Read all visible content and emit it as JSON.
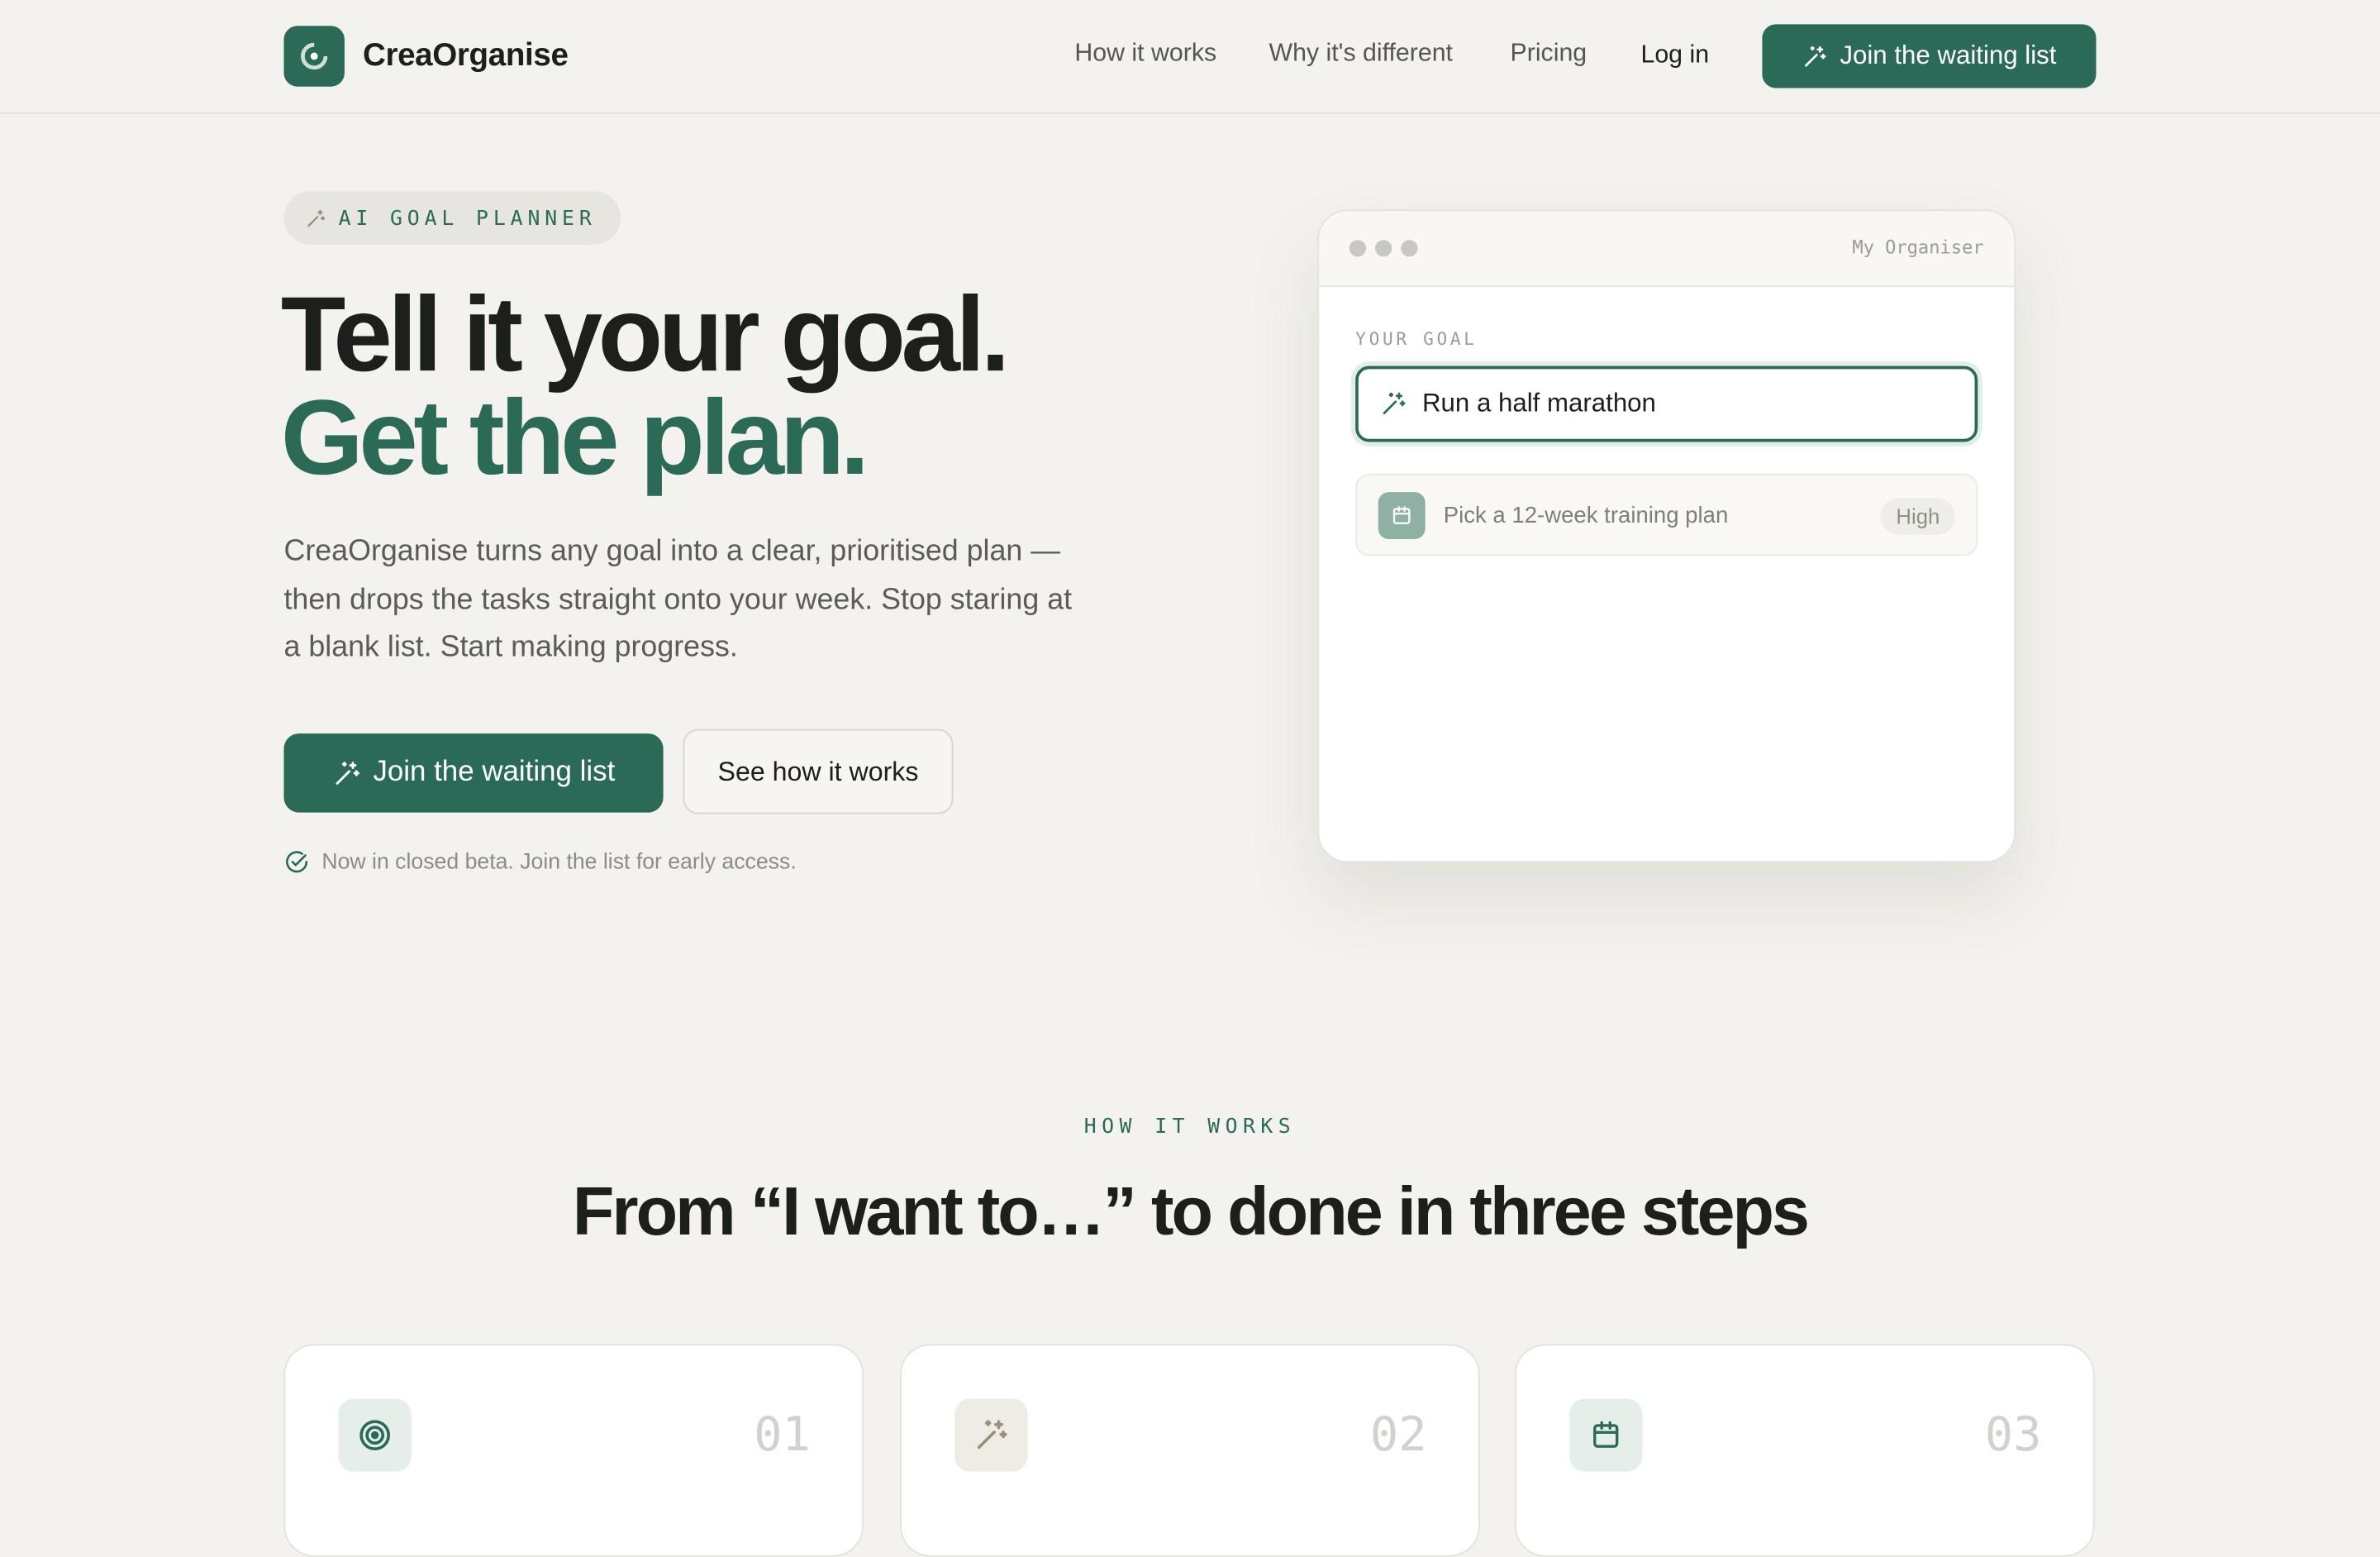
{
  "brand": {
    "name": "CreaOrganise"
  },
  "nav": {
    "links": [
      "How it works",
      "Why it's different",
      "Pricing"
    ],
    "login": "Log in",
    "cta": "Join the waiting list"
  },
  "hero": {
    "chip": "AI GOAL PLANNER",
    "headline_1": "Tell it your goal.",
    "headline_2": "Get the plan.",
    "lead": "CreaOrganise turns any goal into a clear, prioritised plan — then drops the tasks straight onto your week. Stop staring at a blank list. Start making progress.",
    "primary_cta": "Join the waiting list",
    "secondary_cta": "See how it works",
    "beta_note": "Now in closed beta. Join the list for early access."
  },
  "mockup": {
    "window_title": "My Organiser",
    "goal_label": "YOUR GOAL",
    "goal_value": "Run a half marathon",
    "task": {
      "text": "Pick a 12-week training plan",
      "priority": "High"
    }
  },
  "how_it_works": {
    "eyebrow": "HOW IT WORKS",
    "title": "From “I want to…” to done in three steps",
    "steps": [
      {
        "number": "01",
        "icon": "target-icon"
      },
      {
        "number": "02",
        "icon": "sparkle-icon"
      },
      {
        "number": "03",
        "icon": "calendar-icon"
      }
    ]
  },
  "colors": {
    "accent": "#2b6a57",
    "background": "#f3f2ee"
  }
}
